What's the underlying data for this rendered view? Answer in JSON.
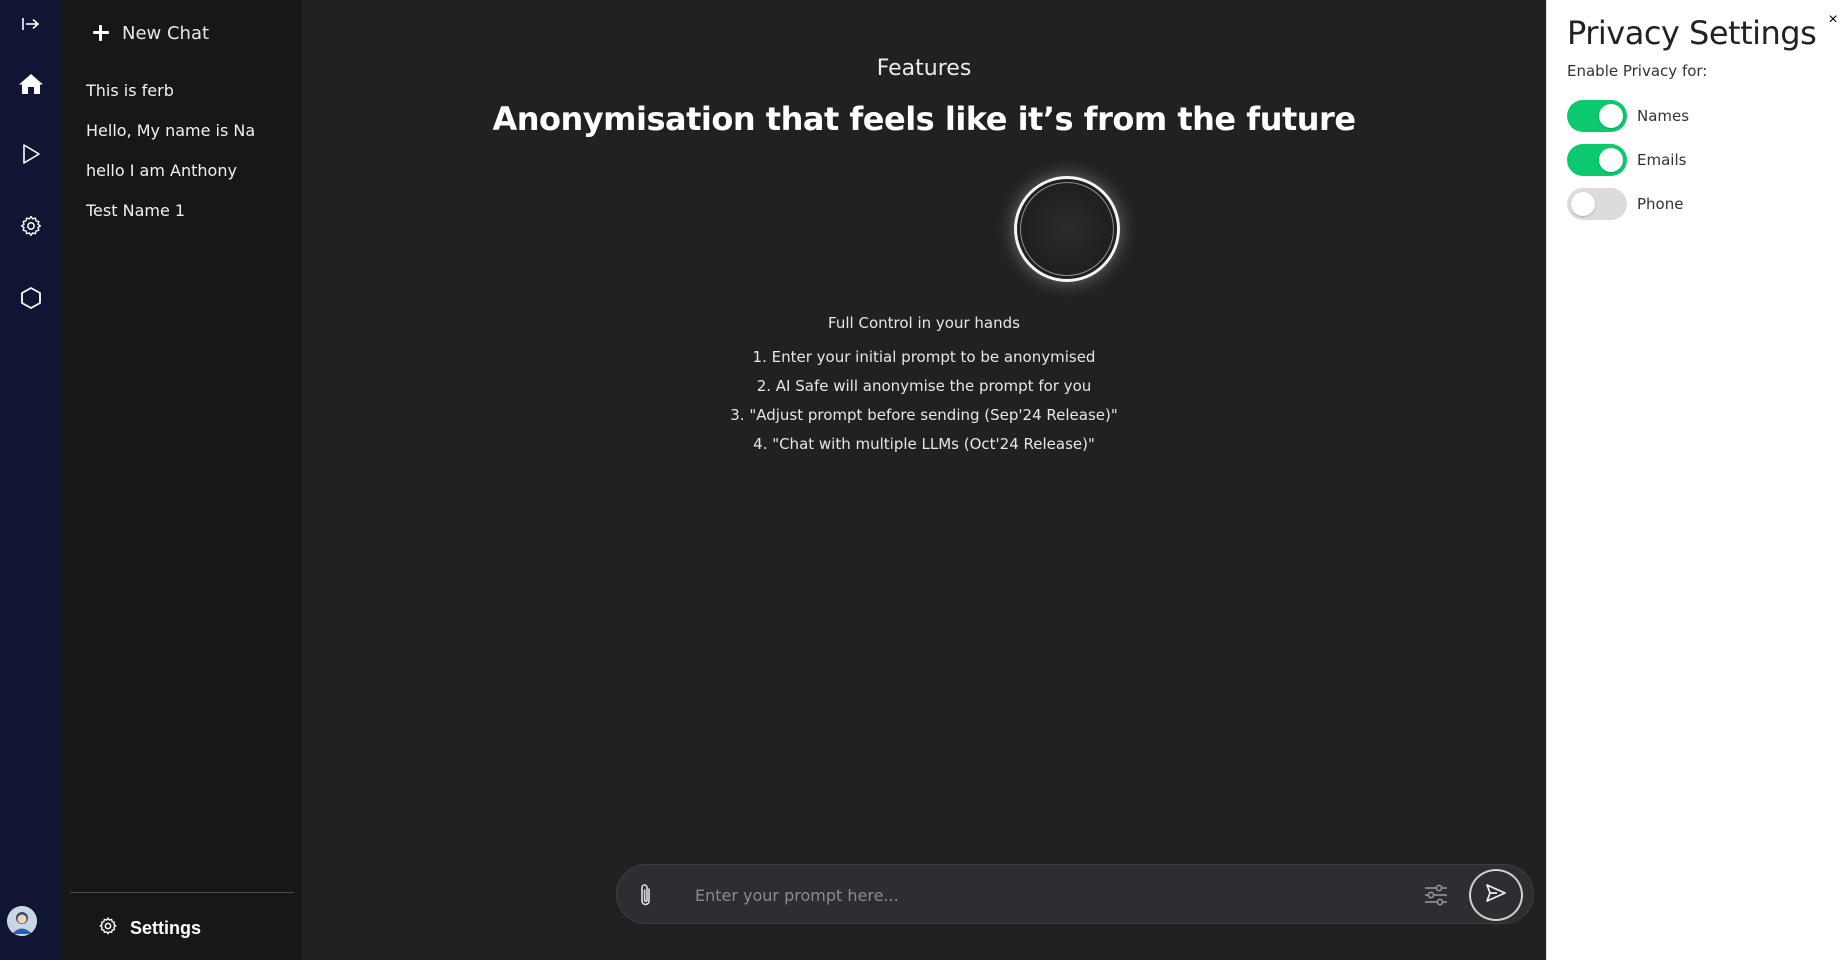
{
  "rail": {
    "icons": [
      "expand-icon",
      "home-icon",
      "play-icon",
      "gear-icon",
      "hexagon-icon"
    ]
  },
  "sidebar": {
    "new_chat_label": "New Chat",
    "history": [
      {
        "label": "This is ferb"
      },
      {
        "label": "Hello, My name is Na"
      },
      {
        "label": "hello I am Anthony"
      },
      {
        "label": "Test Name 1"
      }
    ],
    "settings_label": "Settings"
  },
  "main": {
    "features_label": "Features",
    "headline": "Anonymisation that feels like it’s from the future",
    "intro": "Full Control in your hands",
    "steps": [
      "1. Enter your initial prompt to be anonymised",
      "2. AI Safe will anonymise the prompt for you",
      "3. \"Adjust prompt before sending (Sep'24 Release)\"",
      "4. \"Chat with multiple LLMs (Oct'24 Release)\""
    ]
  },
  "prompt": {
    "placeholder": "Enter your prompt here...",
    "value": ""
  },
  "privacy_panel": {
    "title": "Privacy Settings",
    "subtitle": "Enable Privacy for:",
    "close_symbol": "×",
    "toggles": [
      {
        "label": "Names",
        "enabled": true
      },
      {
        "label": "Emails",
        "enabled": true
      },
      {
        "label": "Phone",
        "enabled": false
      }
    ]
  },
  "colors": {
    "rail_bg": "#0f1532",
    "sidebar_bg": "#171717",
    "main_bg": "#202123",
    "toggle_on": "#0cc96f",
    "toggle_off": "#dcdcdc"
  }
}
